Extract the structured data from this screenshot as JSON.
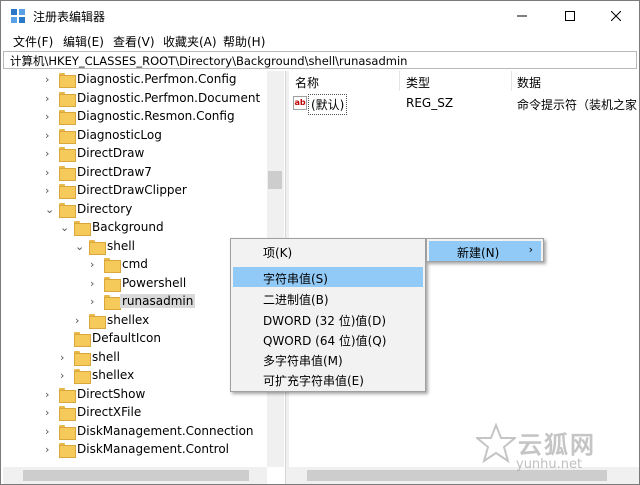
{
  "window": {
    "title": "注册表编辑器",
    "icons": [
      "regedit-icon",
      "minimize-icon",
      "maximize-icon",
      "close-icon"
    ]
  },
  "menubar": {
    "file": "文件(F)",
    "edit": "编辑(E)",
    "view": "查看(V)",
    "favorites": "收藏夹(A)",
    "help": "帮助(H)"
  },
  "address": {
    "path": "计算机\\HKEY_CLASSES_ROOT\\Directory\\Background\\shell\\runasadmin"
  },
  "tree": {
    "items": [
      {
        "label": "Diagnostic.Perfmon.Config"
      },
      {
        "label": "Diagnostic.Perfmon.Document"
      },
      {
        "label": "Diagnostic.Resmon.Config"
      },
      {
        "label": "DiagnosticLog"
      },
      {
        "label": "DirectDraw"
      },
      {
        "label": "DirectDraw7"
      },
      {
        "label": "DirectDrawClipper"
      },
      {
        "label": "Directory"
      },
      {
        "label": "Background"
      },
      {
        "label": "shell"
      },
      {
        "label": "cmd"
      },
      {
        "label": "Powershell"
      },
      {
        "label": "runasadmin"
      },
      {
        "label": "shellex"
      },
      {
        "label": "DefaultIcon"
      },
      {
        "label": "shell"
      },
      {
        "label": "shellex"
      },
      {
        "label": "DirectShow"
      },
      {
        "label": "DirectXFile"
      },
      {
        "label": "DiskManagement.Connection"
      },
      {
        "label": "DiskManagement.Control"
      }
    ]
  },
  "values": {
    "headers": {
      "name": "名称",
      "type": "类型",
      "data": "数据"
    },
    "rows": [
      {
        "name": "(默认)",
        "type": "REG_SZ",
        "data": "命令提示符（装机之家"
      }
    ]
  },
  "context_menu": {
    "items": [
      {
        "label": "项(K)"
      },
      {
        "label": "字符串值(S)"
      },
      {
        "label": "二进制值(B)"
      },
      {
        "label": "DWORD (32 位)值(D)"
      },
      {
        "label": "QWORD (64 位)值(Q)"
      },
      {
        "label": "多字符串值(M)"
      },
      {
        "label": "可扩充字符串值(E)"
      }
    ],
    "new_label": "新建(N)"
  },
  "watermark": {
    "text": "云狐网",
    "url": "yunhu.net"
  }
}
